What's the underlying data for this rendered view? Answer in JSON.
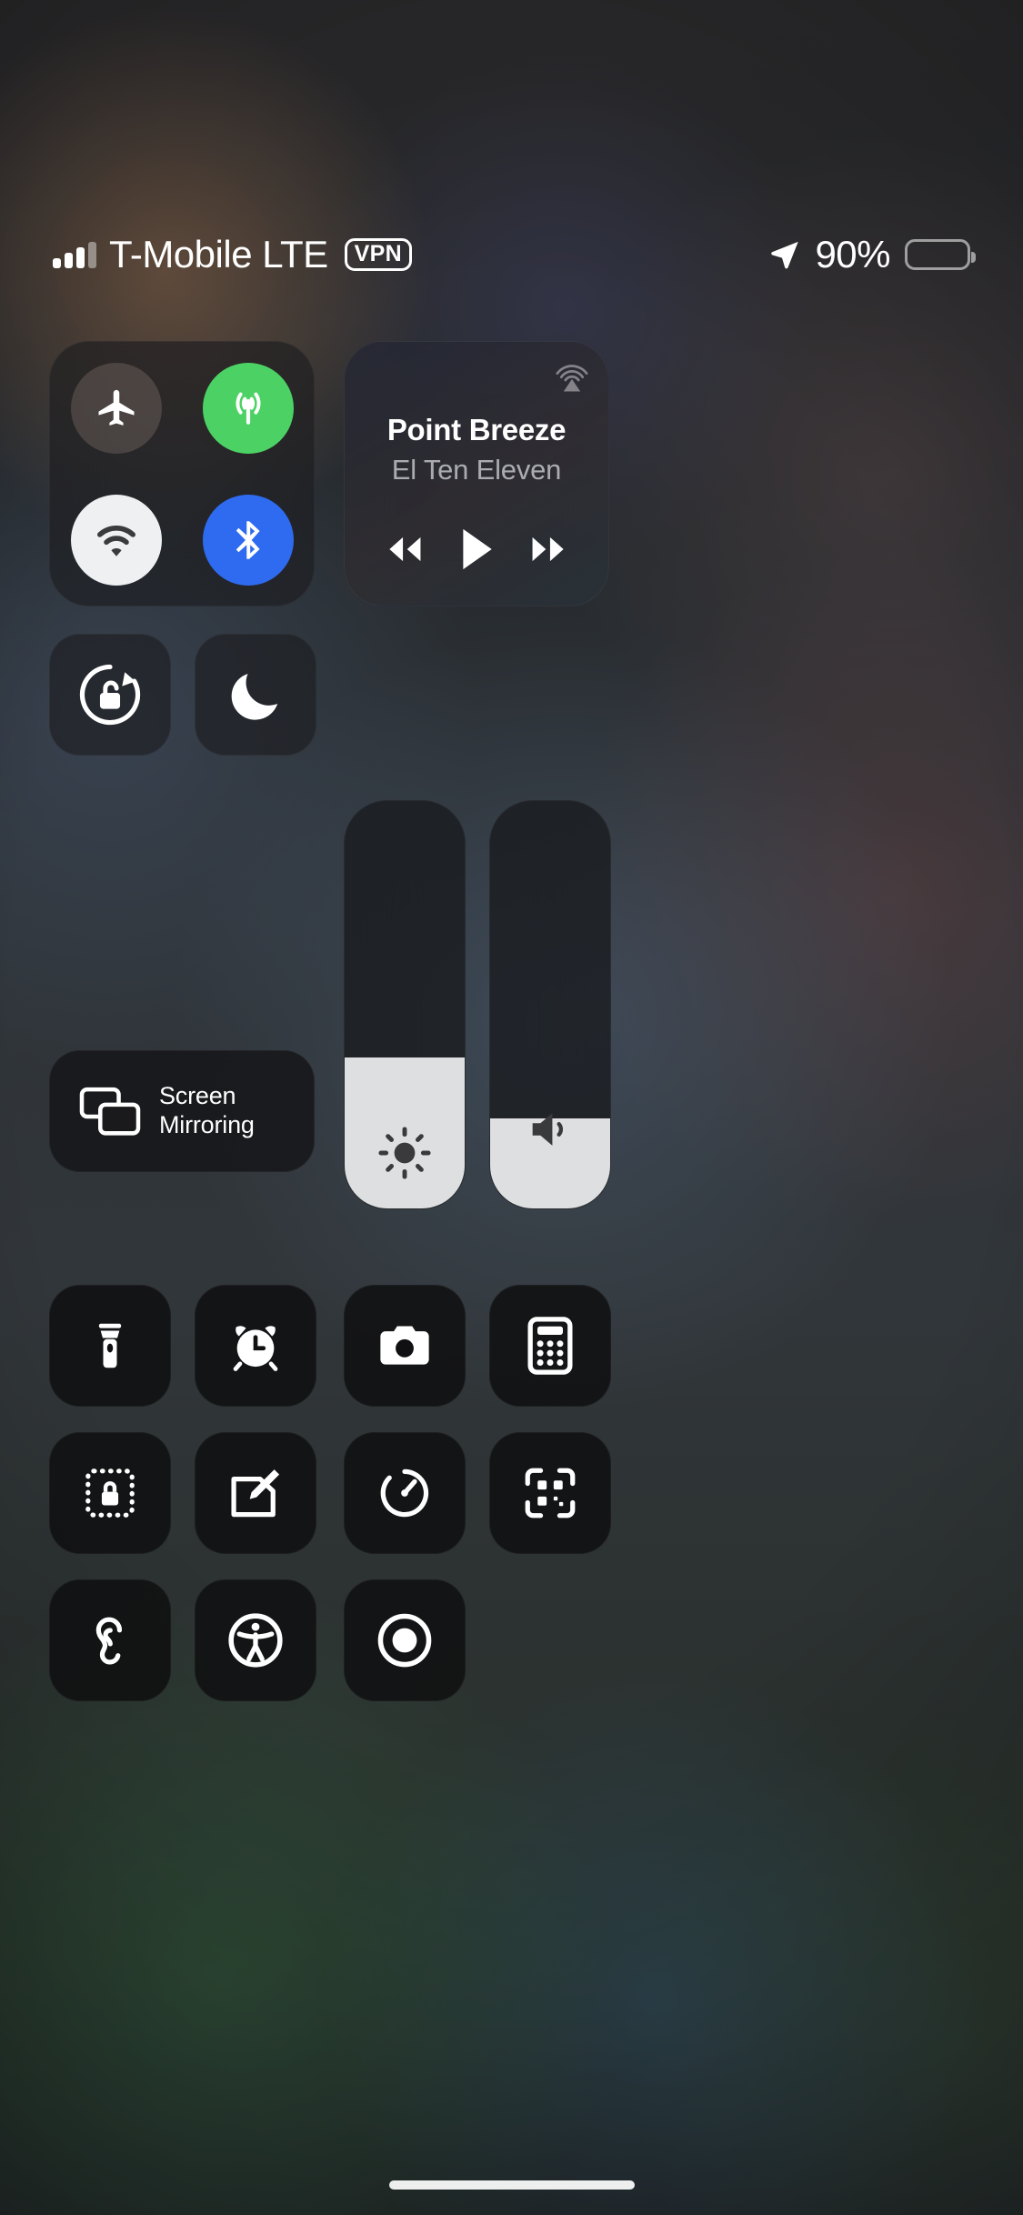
{
  "status_bar": {
    "signal_icon": "cellular-signal-icon",
    "signal_bars_total": 4,
    "signal_bars_filled": 3,
    "carrier": "T-Mobile",
    "network_type": "LTE",
    "carrier_text": "T-Mobile LTE",
    "vpn_badge": "VPN",
    "location_icon": "location-arrow-icon",
    "battery_percent": "90%",
    "battery_level": 90,
    "battery_icon": "battery-icon"
  },
  "connectivity": {
    "airplane": {
      "name": "Airplane Mode",
      "icon": "airplane-icon",
      "state": "off",
      "color": "#3b3330"
    },
    "cellular": {
      "name": "Cellular Data",
      "icon": "cellular-antenna-icon",
      "state": "on",
      "color": "#4cd264"
    },
    "wifi": {
      "name": "Wi-Fi",
      "icon": "wifi-icon",
      "state": "on",
      "color": "#eef0f2"
    },
    "bluetooth": {
      "name": "Bluetooth",
      "icon": "bluetooth-icon",
      "state": "on",
      "color": "#2f6bf0"
    }
  },
  "now_playing": {
    "airplay_icon": "airplay-audio-icon",
    "title": "Point Breeze",
    "artist": "El Ten Eleven",
    "rewind_icon": "rewind-icon",
    "play_icon": "play-icon",
    "forward_icon": "fast-forward-icon",
    "playback_state": "paused"
  },
  "toggles": {
    "rotation_lock": {
      "name": "Portrait Orientation Lock",
      "icon": "rotation-lock-open-icon",
      "state": "off"
    },
    "do_not_disturb": {
      "name": "Do Not Disturb",
      "icon": "moon-icon",
      "state": "off"
    }
  },
  "screen_mirroring": {
    "label_line1": "Screen",
    "label_line2": "Mirroring",
    "icon": "screen-mirroring-icon"
  },
  "sliders": {
    "brightness": {
      "name": "Display Brightness",
      "icon": "brightness-sun-icon",
      "value": 37
    },
    "volume": {
      "name": "Volume",
      "icon": "speaker-volume-icon",
      "value": 22
    }
  },
  "utilities": [
    {
      "name": "Flashlight",
      "icon": "flashlight-icon"
    },
    {
      "name": "Alarm",
      "icon": "alarm-clock-icon"
    },
    {
      "name": "Camera",
      "icon": "camera-icon"
    },
    {
      "name": "Calculator",
      "icon": "calculator-icon"
    },
    {
      "name": "Guided Access",
      "icon": "guided-access-lock-icon"
    },
    {
      "name": "Notes",
      "icon": "notes-pencil-icon"
    },
    {
      "name": "Timer",
      "icon": "timer-icon"
    },
    {
      "name": "Code Scanner",
      "icon": "qr-code-scanner-icon"
    },
    {
      "name": "Hearing",
      "icon": "ear-hearing-icon"
    },
    {
      "name": "Accessibility Shortcuts",
      "icon": "accessibility-icon"
    },
    {
      "name": "Screen Recording",
      "icon": "screen-record-icon"
    }
  ],
  "home_indicator": {
    "name": "home-indicator"
  }
}
